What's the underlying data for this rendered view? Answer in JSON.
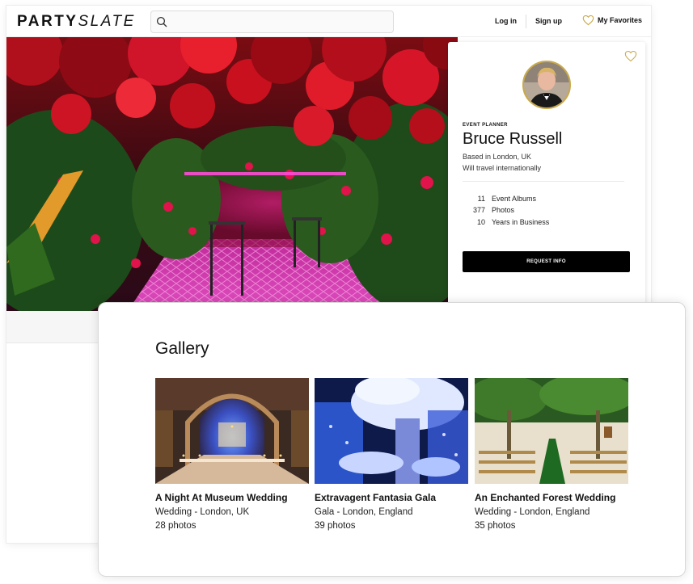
{
  "header": {
    "logo_part1": "PARTY",
    "logo_part2": "SLATE",
    "search_placeholder": "",
    "login_label": "Log in",
    "signup_label": "Sign up",
    "favorites_label": "My Favorites"
  },
  "profile": {
    "role": "EVENT PLANNER",
    "name": "Bruce Russell",
    "based": "Based in London, UK",
    "travel": "Will travel internationally",
    "stats": [
      {
        "value": "11",
        "label": "Event Albums"
      },
      {
        "value": "377",
        "label": "Photos"
      },
      {
        "value": "10",
        "label": "Years in Business"
      }
    ],
    "request_label": "REQUEST INFO"
  },
  "gallery": {
    "title": "Gallery",
    "items": [
      {
        "title": "A Night At Museum Wedding",
        "subtitle": "Wedding - London, UK",
        "count": "28 photos"
      },
      {
        "title": "Extravagent Fantasia Gala",
        "subtitle": "Gala - London, England",
        "count": "39 photos"
      },
      {
        "title": "An Enchanted Forest Wedding",
        "subtitle": "Wedding - London, England",
        "count": "35 photos"
      }
    ]
  },
  "colors": {
    "accent_gold": "#c9a94a",
    "button_black": "#000000"
  },
  "icons": [
    "search-icon",
    "heart-icon",
    "favorite-heart-icon"
  ]
}
